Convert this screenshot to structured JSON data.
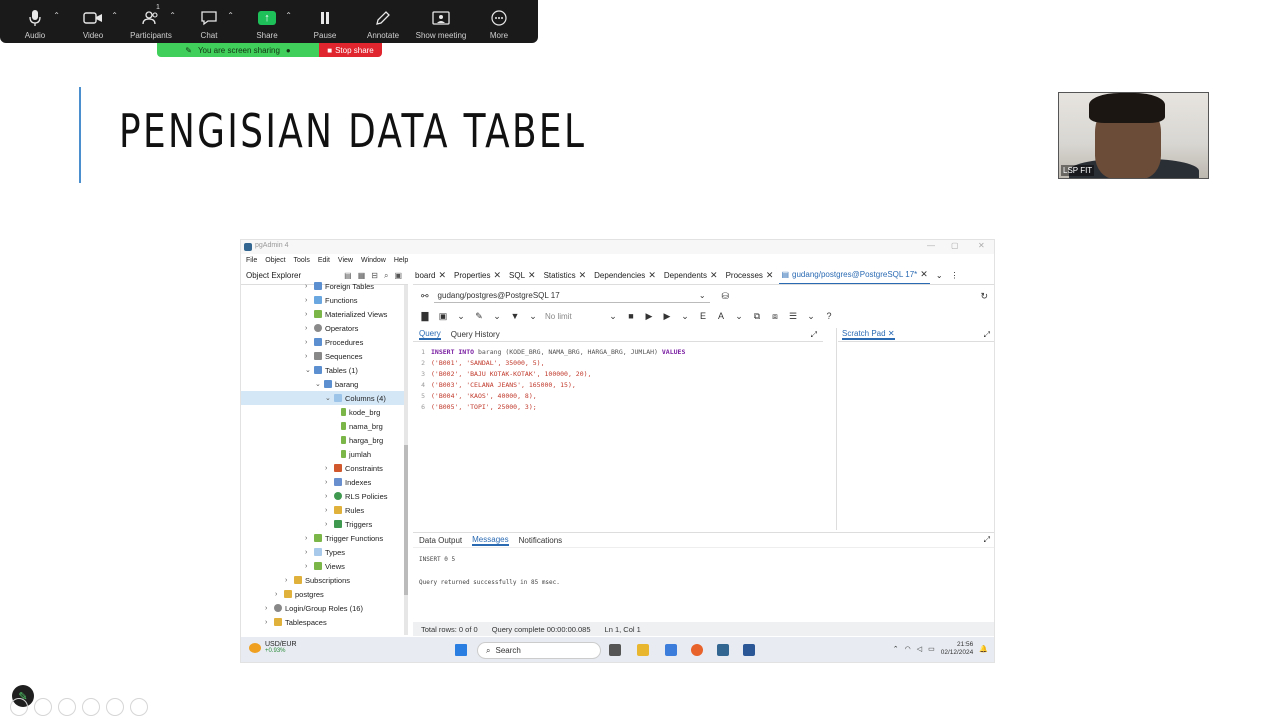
{
  "zoom_toolbar": {
    "buttons": [
      {
        "label": "Audio",
        "icon": "microphone-icon"
      },
      {
        "label": "Video",
        "icon": "video-camera-icon"
      },
      {
        "label": "Participants",
        "icon": "participants-icon",
        "badge": "1"
      },
      {
        "label": "Chat",
        "icon": "chat-icon"
      },
      {
        "label": "Share",
        "icon": "share-screen-icon"
      },
      {
        "label": "Pause",
        "icon": "pause-icon"
      },
      {
        "label": "Annotate",
        "icon": "pencil-icon"
      },
      {
        "label": "Show meeting",
        "icon": "show-meeting-icon"
      },
      {
        "label": "More",
        "icon": "more-dots-icon"
      }
    ],
    "sharing_text": "You are screen sharing",
    "stop_share": "Stop share",
    "share_color": "#1ec05a",
    "stop_color": "#e0252f"
  },
  "slide": {
    "title": "PENGISIAN DATA TABEL",
    "accent_color": "#4c8fcf"
  },
  "webcam": {
    "name": "LSP FIT"
  },
  "pgadmin": {
    "window_title": "pgAdmin 4",
    "menu": [
      "File",
      "Object",
      "Tools",
      "Edit",
      "View",
      "Window",
      "Help"
    ],
    "object_explorer": "Object Explorer",
    "tree": [
      {
        "label": "Foreign Tables"
      },
      {
        "label": "Functions"
      },
      {
        "label": "Materialized Views"
      },
      {
        "label": "Operators"
      },
      {
        "label": "Procedures"
      },
      {
        "label": "Sequences"
      },
      {
        "label": "Tables (1)"
      },
      {
        "label": "barang"
      },
      {
        "label": "Columns (4)"
      },
      {
        "label": "kode_brg"
      },
      {
        "label": "nama_brg"
      },
      {
        "label": "harga_brg"
      },
      {
        "label": "jumlah"
      },
      {
        "label": "Constraints"
      },
      {
        "label": "Indexes"
      },
      {
        "label": "RLS Policies"
      },
      {
        "label": "Rules"
      },
      {
        "label": "Triggers"
      },
      {
        "label": "Trigger Functions"
      },
      {
        "label": "Types"
      },
      {
        "label": "Views"
      },
      {
        "label": "Subscriptions"
      },
      {
        "label": "postgres"
      },
      {
        "label": "Login/Group Roles (16)"
      },
      {
        "label": "Tablespaces"
      }
    ],
    "tabs": [
      "board",
      "Properties",
      "SQL",
      "Statistics",
      "Dependencies",
      "Dependents",
      "Processes",
      "gudang/postgres@PostgreSQL 17*"
    ],
    "connection": "gudang/postgres@PostgreSQL 17",
    "no_limit": "No limit",
    "editor_tabs": [
      "Query",
      "Query History"
    ],
    "scratch_pad": "Scratch Pad",
    "code_lines": [
      {
        "n": "1",
        "kw1": "INSERT INTO",
        "text": " barang (KODE_BRG, NAMA_BRG, HARGA_BRG, JUMLAH) ",
        "kw2": "VALUES"
      },
      {
        "n": "2",
        "text": "('B001', 'SANDAL', 35000, 5),"
      },
      {
        "n": "3",
        "text": "('B002', 'BAJU KOTAK-KOTAK', 100000, 20),"
      },
      {
        "n": "4",
        "text": "('B003', 'CELANA JEANS', 165000, 15),"
      },
      {
        "n": "5",
        "text": "('B004', 'KAOS', 40000, 8),"
      },
      {
        "n": "6",
        "text": "('B005', 'TOPI', 25000, 3);"
      }
    ],
    "output_tabs": [
      "Data Output",
      "Messages",
      "Notifications"
    ],
    "messages": [
      "INSERT 0 5",
      "Query returned successfully in 85 msec."
    ],
    "status": {
      "rows": "Total rows: 0 of 0",
      "complete": "Query complete 00:00:00.085",
      "position": "Ln 1, Col 1"
    },
    "taskbar": {
      "ticker": "USD/EUR",
      "change": "+0.93%",
      "search": "Search",
      "time": "21:56",
      "date": "02/12/2024"
    }
  }
}
